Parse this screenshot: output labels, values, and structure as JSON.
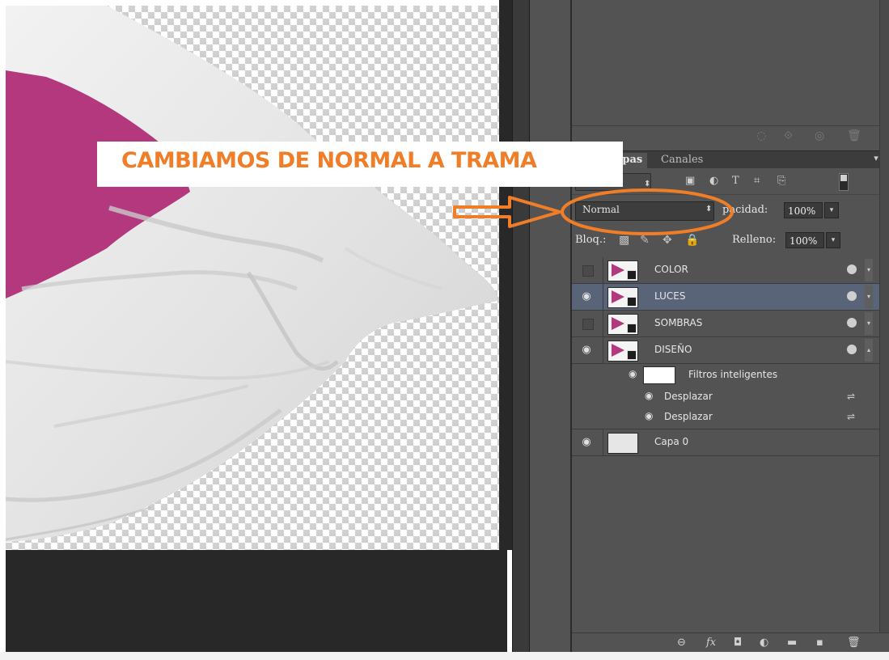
{
  "annotation": {
    "text": "CAMBIAMOS DE NORMAL A TRAMA",
    "color": "#f07d28"
  },
  "layers_panel": {
    "tabs": [
      {
        "label": "Capas",
        "visible_text": "apas"
      },
      {
        "label": "Canales"
      }
    ],
    "blend_mode": "Normal",
    "opacity_label": "Opacidad:",
    "opacity_visible_label": "pacidad:",
    "opacity_value": "100%",
    "lock_label": "Bloq.:",
    "fill_label": "Relleno:",
    "fill_value": "100%",
    "layers": [
      {
        "name": "COLOR",
        "visible": false,
        "selected": false
      },
      {
        "name": "LUCES",
        "visible": true,
        "selected": true
      },
      {
        "name": "SOMBRAS",
        "visible": false,
        "selected": false
      },
      {
        "name": "DISEÑO",
        "visible": true,
        "selected": false
      }
    ],
    "smart_filters_label": "Filtros inteligentes",
    "filters": [
      "Desplazar",
      "Desplazar"
    ],
    "base_layer": {
      "name": "Capa 0",
      "visible": true
    }
  },
  "colors": {
    "panel_bg": "#535353",
    "selected_layer": "#596478",
    "magenta": "#b3387d",
    "workspace": "#282828"
  }
}
